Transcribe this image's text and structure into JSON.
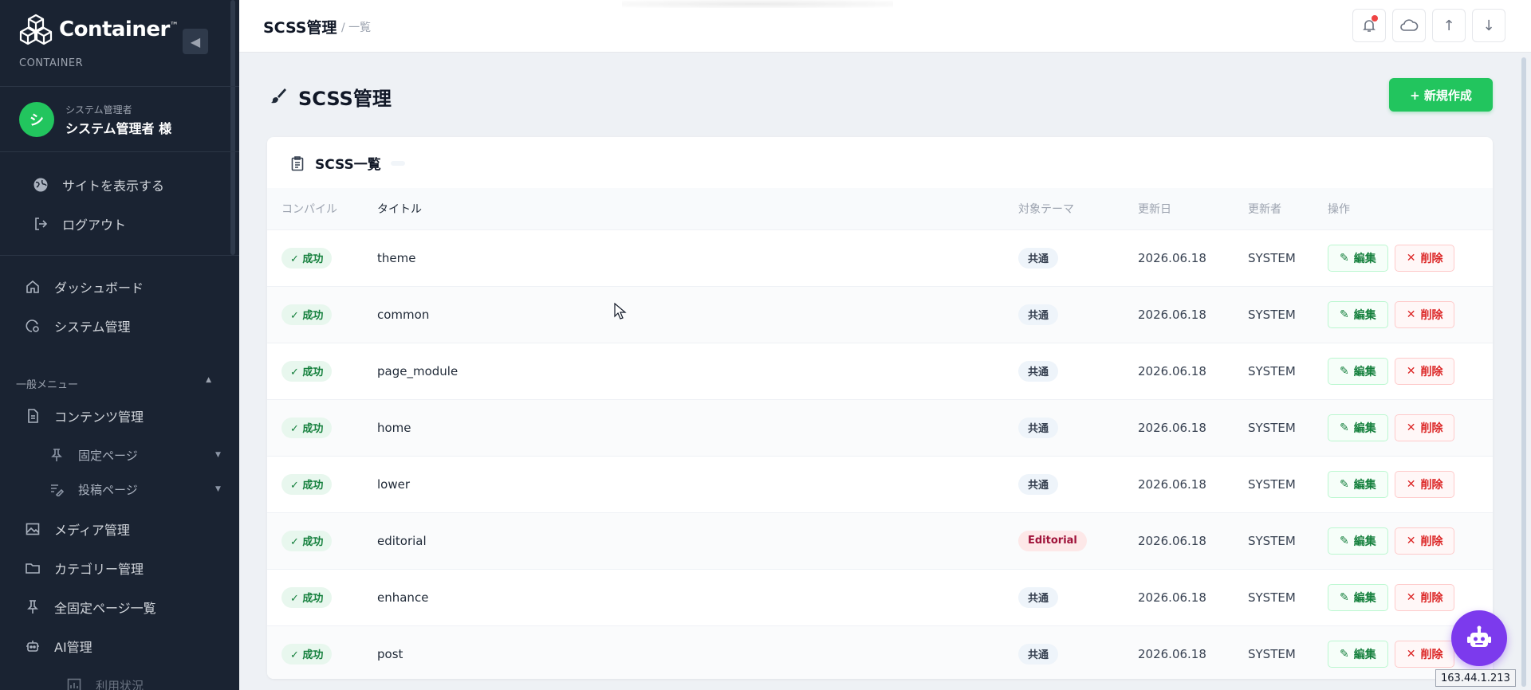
{
  "sidebar": {
    "brand": "Container",
    "brand_tm": "™",
    "brand_sub": "CONTAINER",
    "user": {
      "avatar_letter": "シ",
      "role": "システム管理者",
      "name": "システム管理者 様"
    },
    "links": [
      {
        "label": "サイトを表示する",
        "icon": "globe-icon"
      },
      {
        "label": "ログアウト",
        "icon": "logout-icon"
      }
    ],
    "nav": [
      {
        "label": "ダッシュボード",
        "icon": "home-icon"
      },
      {
        "label": "システム管理",
        "icon": "gear-doc-icon"
      }
    ],
    "section_label": "一般メニュー",
    "general": [
      {
        "label": "コンテンツ管理",
        "icon": "document-icon"
      },
      {
        "label": "固定ページ",
        "icon": "pin-icon"
      },
      {
        "label": "投稿ページ",
        "icon": "edit-list-icon"
      },
      {
        "label": "メディア管理",
        "icon": "image-icon"
      },
      {
        "label": "カテゴリー管理",
        "icon": "folder-icon"
      },
      {
        "label": "全固定ページ一覧",
        "icon": "pin-icon"
      },
      {
        "label": "AI管理",
        "icon": "robot-icon"
      },
      {
        "label": "利用状況",
        "icon": "chart-icon"
      }
    ]
  },
  "header": {
    "title": "SCSS管理",
    "breadcrumb": "/ 一覧"
  },
  "page": {
    "title": "SCSS管理",
    "new_button": "+ 新規作成",
    "card_title": "SCSS一覧"
  },
  "table": {
    "columns": [
      "コンパイル",
      "タイトル",
      "対象テーマ",
      "更新日",
      "更新者",
      "操作"
    ],
    "rows": [
      {
        "compile": "✓ 成功",
        "title": "theme",
        "theme": "共通",
        "date": "2026.06.18",
        "user": "SYSTEM"
      },
      {
        "compile": "✓ 成功",
        "title": "common",
        "theme": "共通",
        "date": "2026.06.18",
        "user": "SYSTEM"
      },
      {
        "compile": "✓ 成功",
        "title": "page_module",
        "theme": "共通",
        "date": "2026.06.18",
        "user": "SYSTEM"
      },
      {
        "compile": "✓ 成功",
        "title": "home",
        "theme": "共通",
        "date": "2026.06.18",
        "user": "SYSTEM"
      },
      {
        "compile": "✓ 成功",
        "title": "lower",
        "theme": "共通",
        "date": "2026.06.18",
        "user": "SYSTEM"
      },
      {
        "compile": "✓ 成功",
        "title": "editorial",
        "theme": "Editorial",
        "date": "2026.06.18",
        "user": "SYSTEM"
      },
      {
        "compile": "✓ 成功",
        "title": "enhance",
        "theme": "共通",
        "date": "2026.06.18",
        "user": "SYSTEM"
      },
      {
        "compile": "✓ 成功",
        "title": "post",
        "theme": "共通",
        "date": "2026.06.18",
        "user": "SYSTEM"
      }
    ],
    "edit_label": "編集",
    "delete_label": "削除"
  },
  "status_bar": {
    "ip": "163.44.1.213"
  },
  "colors": {
    "sidebar_bg": "#1a2332",
    "accent": "#22c55e",
    "danger": "#dc2626",
    "fab": "#7c3aed"
  }
}
